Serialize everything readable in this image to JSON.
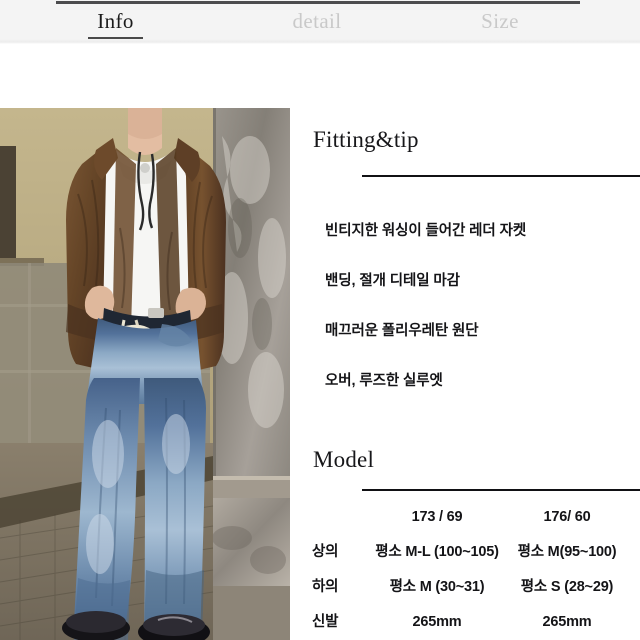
{
  "tabs": [
    {
      "id": "info",
      "label": "Info",
      "active": true
    },
    {
      "id": "detail",
      "label": "detail",
      "active": false
    },
    {
      "id": "size",
      "label": "Size",
      "active": false
    }
  ],
  "photo": {
    "alt": "model-photo",
    "description": "Model wearing vintage-washed brown leather jacket, white shirt and faded wide-leg denim jeans with black loafers, standing by a stone wall"
  },
  "fitting": {
    "heading": "Fitting&tip",
    "bullets": [
      "빈티지한 워싱이 들어간 레더 자켓",
      "밴딩, 절개 디테일 마감",
      "매끄러운 폴리우레탄 원단",
      "오버, 루즈한 실루엣"
    ]
  },
  "model": {
    "heading": "Model",
    "columns": [
      "173 / 69",
      "176/ 60"
    ],
    "rows": [
      {
        "label": "상의",
        "c1": "평소 M-L (100~105)",
        "c2": "평소 M(95~100)"
      },
      {
        "label": "하의",
        "c1": "평소 M (30~31)",
        "c2": "평소 S (28~29)"
      },
      {
        "label": "신발",
        "c1": "265mm",
        "c2": "265mm"
      }
    ]
  },
  "colors": {
    "tabbar_bg": "#f4f4f4",
    "tab_active": "#1b1b1b",
    "tab_inactive": "#c9c9c9",
    "rule": "#111114",
    "text": "#141417"
  }
}
